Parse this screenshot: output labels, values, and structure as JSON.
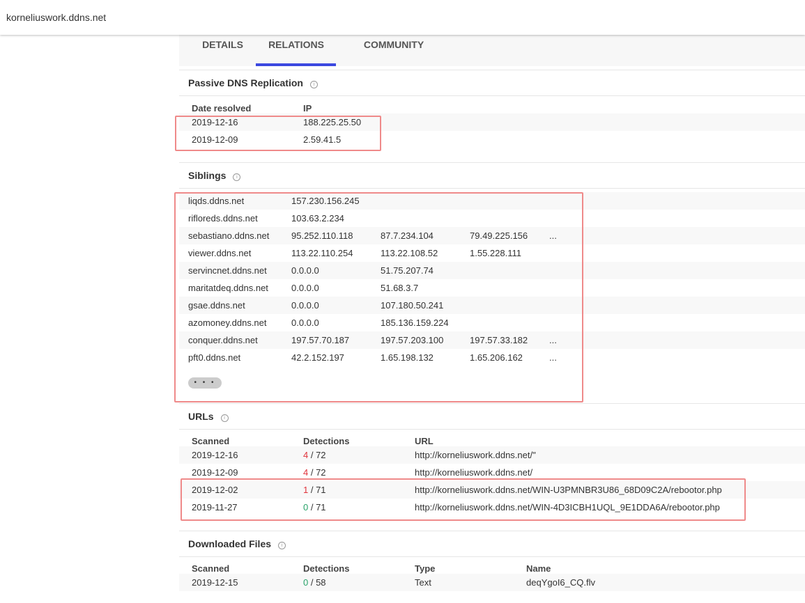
{
  "header": {
    "host": "korneliuswork.ddns.net"
  },
  "tabs": [
    {
      "label": "DETAILS",
      "active": false
    },
    {
      "label": "RELATIONS",
      "active": true
    },
    {
      "label": "COMMUNITY",
      "active": false
    }
  ],
  "pdns": {
    "title": "Passive DNS Replication",
    "headers": [
      "Date resolved",
      "IP"
    ],
    "rows": [
      {
        "date": "2019-12-16",
        "ip": "188.225.25.50"
      },
      {
        "date": "2019-12-09",
        "ip": "2.59.41.5"
      }
    ]
  },
  "siblings": {
    "title": "Siblings",
    "rows": [
      {
        "host": "liqds.ddns.net",
        "ips": [
          "157.230.156.245"
        ],
        "more": ""
      },
      {
        "host": "rifloreds.ddns.net",
        "ips": [
          "103.63.2.234"
        ],
        "more": ""
      },
      {
        "host": "sebastiano.ddns.net",
        "ips": [
          "95.252.110.118",
          "87.7.234.104",
          "79.49.225.156"
        ],
        "more": "..."
      },
      {
        "host": "viewer.ddns.net",
        "ips": [
          "113.22.110.254",
          "113.22.108.52",
          "1.55.228.111"
        ],
        "more": ""
      },
      {
        "host": "servincnet.ddns.net",
        "ips": [
          "0.0.0.0",
          "51.75.207.74"
        ],
        "more": ""
      },
      {
        "host": "maritatdeq.ddns.net",
        "ips": [
          "0.0.0.0",
          "51.68.3.7"
        ],
        "more": ""
      },
      {
        "host": "gsae.ddns.net",
        "ips": [
          "0.0.0.0",
          "107.180.50.241"
        ],
        "more": ""
      },
      {
        "host": "azomoney.ddns.net",
        "ips": [
          "0.0.0.0",
          "185.136.159.224"
        ],
        "more": ""
      },
      {
        "host": "conquer.ddns.net",
        "ips": [
          "197.57.70.187",
          "197.57.203.100",
          "197.57.33.182"
        ],
        "more": "..."
      },
      {
        "host": "pft0.ddns.net",
        "ips": [
          "42.2.152.197",
          "1.65.198.132",
          "1.65.206.162"
        ],
        "more": "..."
      }
    ],
    "more_label": "• • •"
  },
  "urls": {
    "title": "URLs",
    "headers": [
      "Scanned",
      "Detections",
      "URL"
    ],
    "rows": [
      {
        "scanned": "2019-12-16",
        "det": "4",
        "total": " / 72",
        "url": "http://korneliuswork.ddns.net/\""
      },
      {
        "scanned": "2019-12-09",
        "det": "4",
        "total": " / 72",
        "url": "http://korneliuswork.ddns.net/"
      },
      {
        "scanned": "2019-12-02",
        "det": "1",
        "total": " / 71",
        "url": "http://korneliuswork.ddns.net/WIN-U3PMNBR3U86_68D09C2A/rebootor.php"
      },
      {
        "scanned": "2019-11-27",
        "det": "0",
        "total": " / 71",
        "url": "http://korneliuswork.ddns.net/WIN-4D3ICBH1UQL_9E1DDA6A/rebootor.php"
      }
    ]
  },
  "files": {
    "title": "Downloaded Files",
    "headers": [
      "Scanned",
      "Detections",
      "Type",
      "Name"
    ],
    "rows": [
      {
        "scanned": "2019-12-15",
        "det": "0",
        "total": " / 58",
        "type": "Text",
        "name": "deqYgoI6_CQ.flv"
      }
    ]
  },
  "colors": {
    "accent": "#3b48e0",
    "highlight_box": "#ef8a8a",
    "detect_red": "#e0343c",
    "detect_green": "#29a36a"
  }
}
